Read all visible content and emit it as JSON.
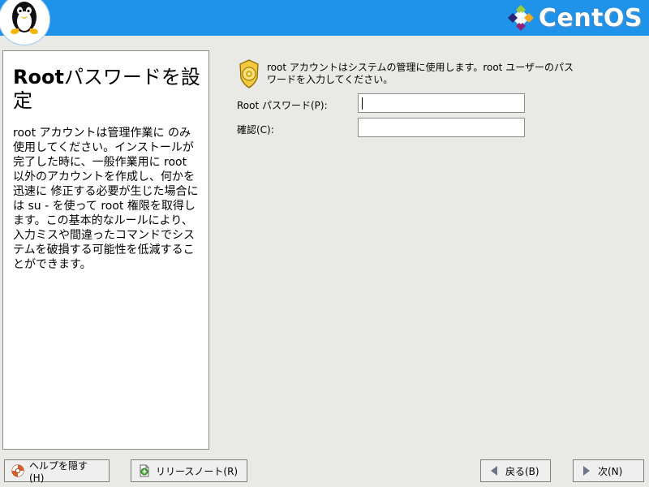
{
  "header": {
    "brand": "CentOS",
    "accent": "#1f93ea"
  },
  "left_panel": {
    "title_prefix": "Root",
    "title_suffix": "パスワードを設定",
    "body": "root アカウントは管理作業に のみ 使用してください。インストールが完了した時に、一般作業用に root 以外のアカウントを作成し、何かを迅速に 修正する必要が生じた場合には su - を使って root 権限を取得します。この基本的なルールにより、 入力ミスや間違ったコマンドでシステムを破損する可能性を低減することができます。"
  },
  "intro": {
    "text": "root アカウントはシステムの管理に使用します。root ユーザーのパスワードを入力してください。"
  },
  "form": {
    "password_label": "Root パスワード(P):",
    "confirm_label": "確認(C):",
    "password_value": "",
    "confirm_value": ""
  },
  "buttons": {
    "hide_help": "ヘルプを隠す(H)",
    "release_notes": "リリースノート(R)",
    "back": "戻る(B)",
    "next": "次(N)"
  },
  "icons": {
    "header_left": "tux-penguin-icon",
    "header_right": "centos-logo-icon",
    "security": "badge-icon",
    "help": "lifebuoy-icon",
    "notes": "document-plus-icon",
    "back": "left-arrow-icon",
    "next": "right-arrow-icon"
  }
}
